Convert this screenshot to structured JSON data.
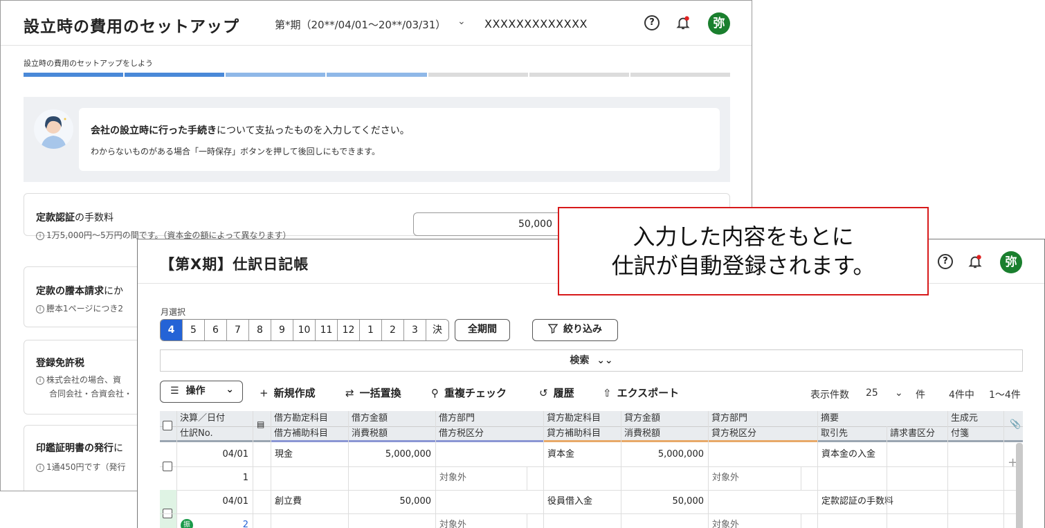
{
  "back_window": {
    "title": "設立時の費用のセットアップ",
    "period": "第*期（20**/04/01〜20**/03/31）",
    "company": "XXXXXXXXXXXXX",
    "avatar_text": "弥",
    "step_label": "設立時の費用のセットアップをしよう",
    "steps": [
      {
        "color": "#4a89d8"
      },
      {
        "color": "#4a89d8"
      },
      {
        "color": "#8fb8e8"
      },
      {
        "color": "#8fb8e8"
      },
      {
        "color": "#dcdcdc"
      },
      {
        "color": "#dcdcdc"
      },
      {
        "color": "#dcdcdc"
      }
    ],
    "guide": {
      "line1_bold": "会社の設立時に行った手続き",
      "line1_rest": "について支払ったものを入力してください。",
      "line2": "わからないものがある場合「一時保存」ボタンを押して後回しにもできます。"
    },
    "cards": [
      {
        "title_bold": "定款認証",
        "title_rest": "の手数料",
        "sub": "1万5,000円〜5万円の間です。（資本金の額によって異なります）",
        "amount": "50,000"
      },
      {
        "title_bold": "定款の謄本請求",
        "title_rest": "にか",
        "sub": "謄本1ページにつき2"
      },
      {
        "title_bold": "登録免許税",
        "title_rest": "",
        "sub": "株式会社の場合、資",
        "sub2": "合同会社・合資会社・"
      },
      {
        "title_bold": "印鑑証明書の発行",
        "title_rest": "に",
        "sub": "1通450円です（発行"
      }
    ]
  },
  "callout": {
    "line1": "入力した内容をもとに",
    "line2": "仕訳が自動登録されます。",
    "border_color": "#d7191a"
  },
  "front_window": {
    "title": "【第X期】仕訳日記帳",
    "avatar_text": "弥",
    "month_label": "月選択",
    "months": [
      "4",
      "5",
      "6",
      "7",
      "8",
      "9",
      "10",
      "11",
      "12",
      "1",
      "2",
      "3",
      "決"
    ],
    "selected_month": "4",
    "all_period": "全期間",
    "filter": "絞り込み",
    "search": "検索",
    "toolbar": {
      "operate": "操作",
      "new": "新規作成",
      "replace": "一括置換",
      "dup_check": "重複チェック",
      "history": "履歴",
      "export": "エクスポート",
      "per_page_label": "表示件数",
      "per_page": "25",
      "per_page_unit": "件",
      "total": "4件中",
      "range": "1〜4件"
    },
    "table": {
      "header_row1": [
        "決算／日付",
        "借方勘定科目",
        "借方金額",
        "借方部門",
        "貸方勘定科目",
        "貸方金額",
        "貸方部門",
        "摘要",
        "生成元"
      ],
      "header_row2": [
        "仕訳No.",
        "借方補助科目",
        "消費税額",
        "借方税区分",
        "貸方補助科目",
        "消費税額",
        "貸方税区分",
        "取引先",
        "請求書区分",
        "付箋"
      ],
      "rows": [
        {
          "date": "04/01",
          "no": "1",
          "debit_account": "現金",
          "debit_amount": "5,000,000",
          "debit_tax": "対象外",
          "credit_account": "資本金",
          "credit_amount": "5,000,000",
          "credit_tax": "対象外",
          "memo": "資本金の入金"
        },
        {
          "date": "04/01",
          "no": "2",
          "debit_account": "創立費",
          "debit_amount": "50,000",
          "debit_tax": "対象外",
          "credit_account": "役員借入金",
          "credit_amount": "50,000",
          "credit_tax": "対象外",
          "memo": "定款認証の手数料",
          "badge": "振"
        }
      ]
    },
    "accent_debit": "#8a96d4",
    "accent_credit": "#e8a968",
    "accent_memo": "#9aa5b1"
  }
}
